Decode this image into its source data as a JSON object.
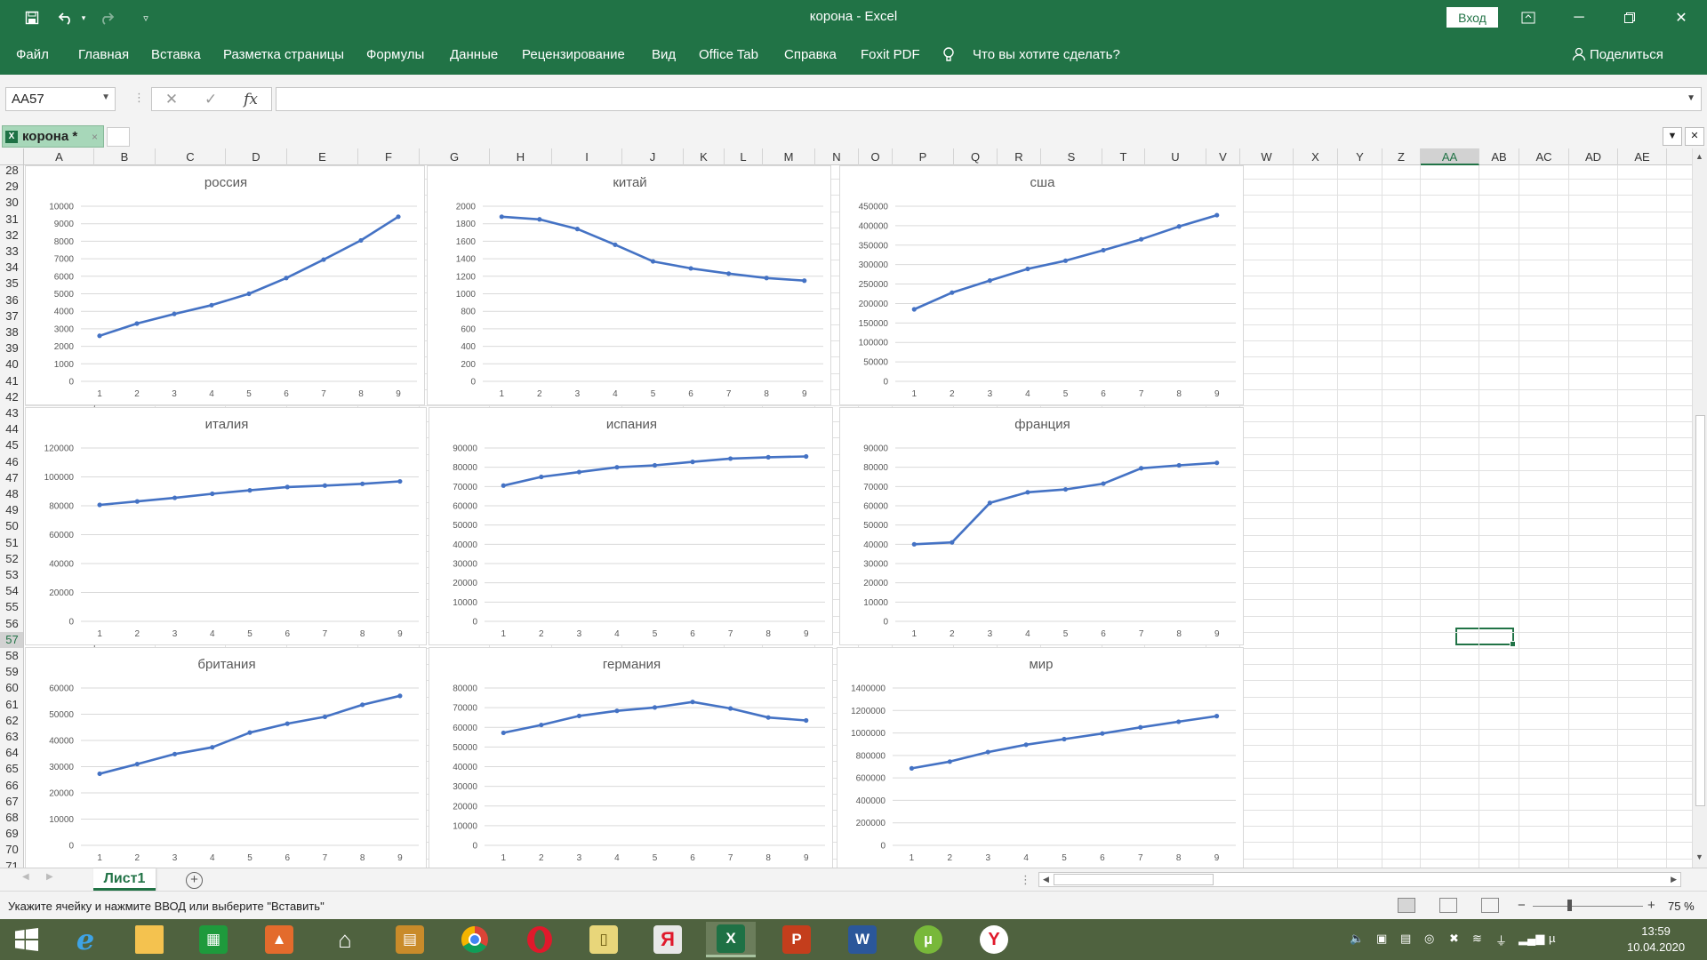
{
  "app": {
    "title": "корона  -  Excel",
    "login_label": "Вход",
    "share_label": "Поделиться"
  },
  "ribbon_tabs": [
    "Файл",
    "Главная",
    "Вставка",
    "Разметка страницы",
    "Формулы",
    "Данные",
    "Рецензирование",
    "Вид",
    "Office Tab",
    "Справка",
    "Foxit PDF",
    "Что вы хотите сделать?"
  ],
  "formula_bar": {
    "name_box": "AA57",
    "fx": "fx",
    "value": ""
  },
  "doc_tab": {
    "label": "корона *",
    "close": "×"
  },
  "columns": [
    "A",
    "B",
    "C",
    "D",
    "E",
    "F",
    "G",
    "H",
    "I",
    "J",
    "K",
    "L",
    "M",
    "N",
    "O",
    "P",
    "Q",
    "R",
    "S",
    "T",
    "U",
    "V",
    "W",
    "X",
    "Y",
    "Z",
    "AA",
    "AB",
    "AC",
    "AD",
    "AE"
  ],
  "selected_column": "AA",
  "rows": [
    "28",
    "29",
    "30",
    "31",
    "32",
    "33",
    "34",
    "35",
    "36",
    "37",
    "38",
    "39",
    "40",
    "41",
    "42",
    "43",
    "44",
    "45",
    "46",
    "47",
    "48",
    "49",
    "50",
    "51",
    "52",
    "53",
    "54",
    "55",
    "56",
    "57",
    "58",
    "59",
    "60",
    "61",
    "62",
    "63",
    "64",
    "65",
    "66",
    "67",
    "68",
    "69",
    "70",
    "71"
  ],
  "selected_row": "57",
  "sheet_tab": "Лист1",
  "status": {
    "message": "Укажите ячейку и нажмите ВВОД или выберите \"Вставить\"",
    "zoom": "75 %"
  },
  "clock": {
    "time": "13:59",
    "date": "10.04.2020"
  },
  "colors": {
    "accent": "#217346",
    "series": "#4472c4"
  },
  "chart_data": [
    {
      "type": "line",
      "title": "россия",
      "categories": [
        "1",
        "2",
        "3",
        "4",
        "5",
        "6",
        "7",
        "8",
        "9"
      ],
      "values": [
        2600,
        3300,
        3850,
        4350,
        5000,
        5900,
        6950,
        8050,
        9400
      ],
      "ylim": [
        0,
        10000
      ],
      "yticks": [
        0,
        1000,
        2000,
        3000,
        4000,
        5000,
        6000,
        7000,
        8000,
        9000,
        10000
      ]
    },
    {
      "type": "line",
      "title": "китай",
      "categories": [
        "1",
        "2",
        "3",
        "4",
        "5",
        "6",
        "7",
        "8",
        "9"
      ],
      "values": [
        1880,
        1850,
        1740,
        1560,
        1370,
        1290,
        1230,
        1180,
        1150
      ],
      "ylim": [
        0,
        2000
      ],
      "yticks": [
        0,
        200,
        400,
        600,
        800,
        1000,
        1200,
        1400,
        1600,
        1800,
        2000
      ]
    },
    {
      "type": "line",
      "title": "сша",
      "categories": [
        "1",
        "2",
        "3",
        "4",
        "5",
        "6",
        "7",
        "8",
        "9"
      ],
      "values": [
        185000,
        228000,
        259000,
        289000,
        310000,
        337000,
        365000,
        398000,
        427000
      ],
      "ylim": [
        0,
        450000
      ],
      "yticks": [
        0,
        50000,
        100000,
        150000,
        200000,
        250000,
        300000,
        350000,
        400000,
        450000
      ]
    },
    {
      "type": "line",
      "title": "италия",
      "categories": [
        "1",
        "2",
        "3",
        "4",
        "5",
        "6",
        "7",
        "8",
        "9"
      ],
      "values": [
        80600,
        83000,
        85500,
        88300,
        90700,
        93000,
        94000,
        95200,
        96900
      ],
      "ylim": [
        0,
        120000
      ],
      "yticks": [
        0,
        20000,
        40000,
        60000,
        80000,
        100000,
        120000
      ]
    },
    {
      "type": "line",
      "title": "испания",
      "categories": [
        "1",
        "2",
        "3",
        "4",
        "5",
        "6",
        "7",
        "8",
        "9"
      ],
      "values": [
        70500,
        75000,
        77500,
        80000,
        81000,
        82800,
        84500,
        85200,
        85600
      ],
      "ylim": [
        0,
        90000
      ],
      "yticks": [
        0,
        10000,
        20000,
        30000,
        40000,
        50000,
        60000,
        70000,
        80000,
        90000
      ]
    },
    {
      "type": "line",
      "title": "франция",
      "categories": [
        "1",
        "2",
        "3",
        "4",
        "5",
        "6",
        "7",
        "8",
        "9"
      ],
      "values": [
        40000,
        41000,
        61500,
        67000,
        68500,
        71500,
        79500,
        81000,
        82300
      ],
      "ylim": [
        0,
        90000
      ],
      "yticks": [
        0,
        10000,
        20000,
        30000,
        40000,
        50000,
        60000,
        70000,
        80000,
        90000
      ]
    },
    {
      "type": "line",
      "title": "британия",
      "categories": [
        "1",
        "2",
        "3",
        "4",
        "5",
        "6",
        "7",
        "8",
        "9"
      ],
      "values": [
        27300,
        31000,
        34800,
        37400,
        43000,
        46400,
        49000,
        53600,
        57000
      ],
      "ylim": [
        0,
        60000
      ],
      "yticks": [
        0,
        10000,
        20000,
        30000,
        40000,
        50000,
        60000
      ]
    },
    {
      "type": "line",
      "title": "германия",
      "categories": [
        "1",
        "2",
        "3",
        "4",
        "5",
        "6",
        "7",
        "8",
        "9"
      ],
      "values": [
        57200,
        61200,
        65800,
        68400,
        70100,
        72900,
        69600,
        65000,
        63500
      ],
      "ylim": [
        0,
        80000
      ],
      "yticks": [
        0,
        10000,
        20000,
        30000,
        40000,
        50000,
        60000,
        70000,
        80000
      ]
    },
    {
      "type": "line",
      "title": "мир",
      "categories": [
        "1",
        "2",
        "3",
        "4",
        "5",
        "6",
        "7",
        "8",
        "9"
      ],
      "values": [
        685000,
        745000,
        830000,
        895000,
        945000,
        995000,
        1050000,
        1100000,
        1150000
      ],
      "ylim": [
        0,
        1400000
      ],
      "yticks": [
        0,
        200000,
        400000,
        600000,
        800000,
        1000000,
        1200000,
        1400000
      ]
    }
  ]
}
